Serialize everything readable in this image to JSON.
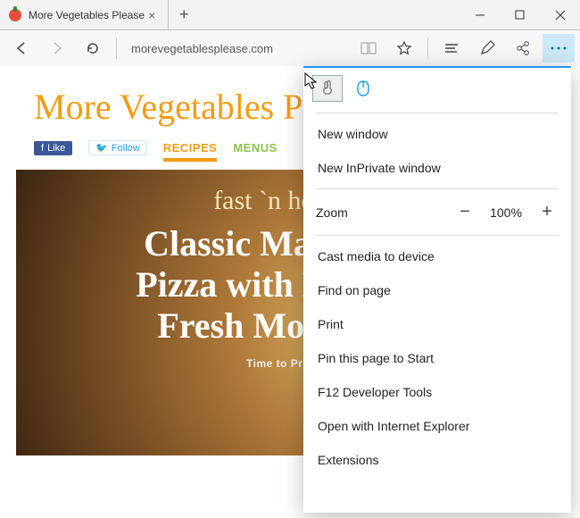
{
  "tab": {
    "title": "More Vegetables Please"
  },
  "addressbar": {
    "url": "morevegetablesplease.com"
  },
  "site": {
    "title": "More Vegetables Please",
    "social": {
      "like": "Like",
      "follow": "Follow"
    },
    "nav": {
      "recipes": "RECIPES",
      "menus": "MENUS"
    },
    "hero": {
      "tag": "fast `n healthy",
      "heading": "Classic Margherita Pizza with Basil and Fresh Mozzarella",
      "meta": "Time to Prepare"
    }
  },
  "menu": {
    "new_window": "New window",
    "new_inprivate": "New InPrivate window",
    "zoom_label": "Zoom",
    "zoom_value": "100%",
    "cast": "Cast media to device",
    "find": "Find on page",
    "print": "Print",
    "pin": "Pin this page to Start",
    "devtools": "F12 Developer Tools",
    "open_ie": "Open with Internet Explorer",
    "extensions": "Extensions"
  }
}
